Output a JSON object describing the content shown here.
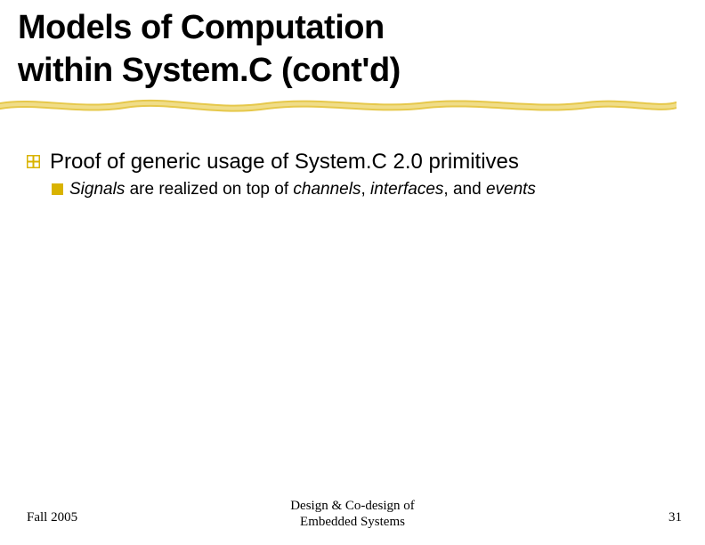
{
  "title": {
    "line1": "Models of Computation",
    "line2": "within System.C (cont'd)"
  },
  "content": {
    "l1_text": "Proof of generic usage of System.C 2.0 primitives",
    "l2": {
      "i1": "Signals",
      "t1": " are realized on top of ",
      "i2": "channels",
      "t2": ", ",
      "i3": "interfaces",
      "t3": ", and ",
      "i4": "events"
    }
  },
  "footer": {
    "left": "Fall 2005",
    "center_l1": "Design & Co-design of",
    "center_l2": "Embedded Systems",
    "right": "31"
  },
  "colors": {
    "accent": "#d9b300"
  }
}
